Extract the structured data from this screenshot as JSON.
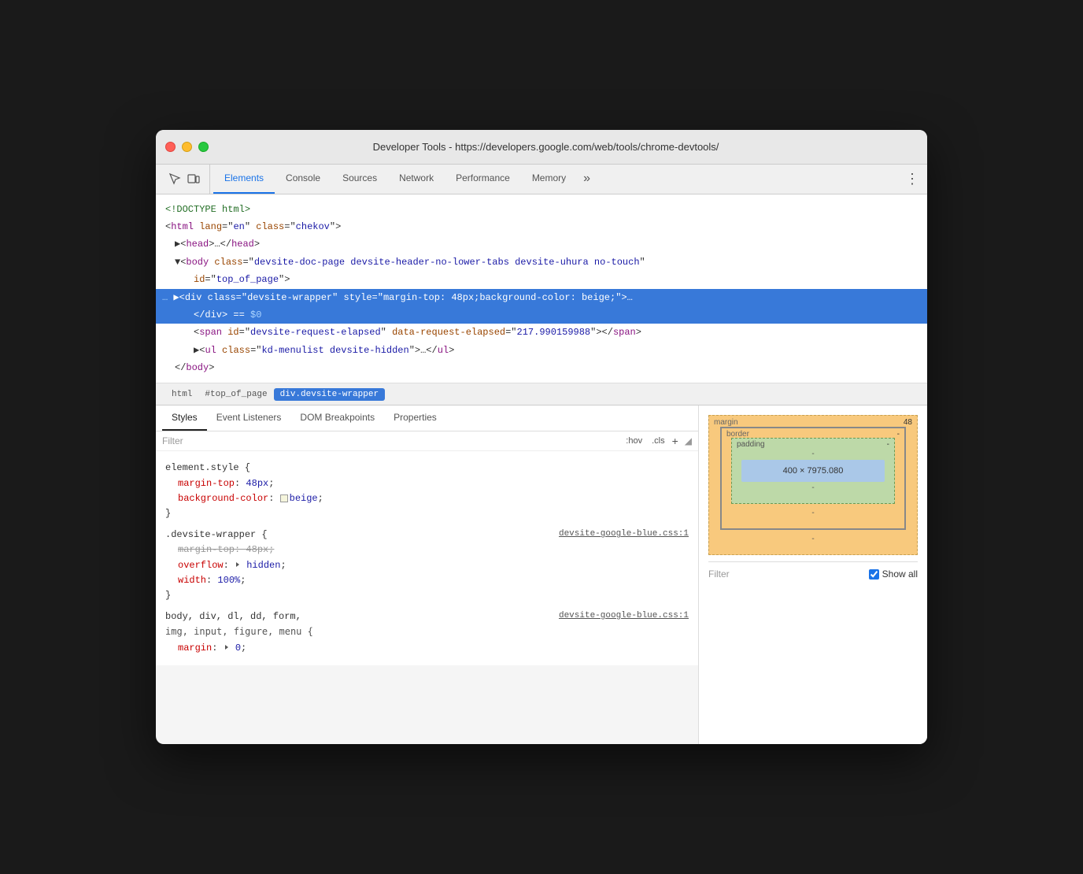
{
  "window": {
    "title": "Developer Tools - https://developers.google.com/web/tools/chrome-devtools/"
  },
  "tabs": {
    "elements": "Elements",
    "console": "Console",
    "sources": "Sources",
    "network": "Network",
    "performance": "Performance",
    "memory": "Memory",
    "more": "»",
    "active": "elements"
  },
  "dom": {
    "lines": [
      {
        "text": "<!DOCTYPE html>",
        "type": "comment",
        "indent": 0
      },
      {
        "text": "<html lang=\"en\" class=\"chekov\">",
        "type": "normal",
        "indent": 0
      },
      {
        "text": "▶<head>…</head>",
        "type": "normal",
        "indent": 1
      },
      {
        "text": "▼<body class=\"devsite-doc-page devsite-header-no-lower-tabs devsite-uhura no-touch\"",
        "type": "normal",
        "indent": 1
      },
      {
        "text": "id=\"top_of_page\">",
        "type": "normal",
        "indent": 2
      },
      {
        "text": "… ▶<div class=\"devsite-wrapper\" style=\"margin-top: 48px;background-color: beige;\">…",
        "type": "selected",
        "indent": 2
      },
      {
        "text": "</div> == $0",
        "type": "selected-close",
        "indent": 3
      },
      {
        "text": "<span id=\"devsite-request-elapsed\" data-request-elapsed=\"217.990159988\"></span>",
        "type": "normal",
        "indent": 3
      },
      {
        "text": "▶<ul class=\"kd-menulist devsite-hidden\">…</ul>",
        "type": "normal",
        "indent": 3
      },
      {
        "text": "</body>",
        "type": "normal",
        "indent": 1
      }
    ]
  },
  "breadcrumbs": [
    {
      "label": "html",
      "active": false
    },
    {
      "label": "#top_of_page",
      "active": false
    },
    {
      "label": "div.devsite-wrapper",
      "active": true
    }
  ],
  "sub_tabs": [
    {
      "label": "Styles",
      "active": true
    },
    {
      "label": "Event Listeners",
      "active": false
    },
    {
      "label": "DOM Breakpoints",
      "active": false
    },
    {
      "label": "Properties",
      "active": false
    }
  ],
  "filter": {
    "placeholder": "Filter",
    "hov_btn": ":hov",
    "cls_btn": ".cls",
    "plus_btn": "+"
  },
  "css_rules": [
    {
      "selector": "element.style {",
      "props": [
        {
          "prop": "margin-top:",
          "value": "48px;",
          "strikethrough": false
        },
        {
          "prop": "background-color:",
          "value": "beige;",
          "strikethrough": false,
          "has_swatch": true
        }
      ],
      "file": null
    },
    {
      "selector": ".devsite-wrapper {",
      "props": [
        {
          "prop": "margin-top: 48px;",
          "value": "",
          "strikethrough": true
        },
        {
          "prop": "overflow:",
          "value": "hidden;",
          "strikethrough": false,
          "has_triangle": true
        },
        {
          "prop": "width:",
          "value": "100%;",
          "strikethrough": false
        }
      ],
      "file": "devsite-google-blue.css:1"
    },
    {
      "selector": "body, div, dl, dd, form,",
      "props": [
        {
          "prop": "img, input, figure, menu {",
          "value": "",
          "strikethrough": false
        },
        {
          "prop": "margin:",
          "value": "0;",
          "strikethrough": false,
          "has_triangle": true
        }
      ],
      "file": "devsite-google-blue.css:1"
    }
  ],
  "box_model": {
    "margin_label": "margin",
    "margin_val": "48",
    "border_label": "border",
    "border_val": "-",
    "padding_label": "padding",
    "padding_val": "-",
    "content": "400 × 7975.080",
    "side_vals": [
      "-",
      "-",
      "-"
    ]
  },
  "computed_filter": {
    "label": "Filter",
    "show_all_label": "Show all"
  }
}
